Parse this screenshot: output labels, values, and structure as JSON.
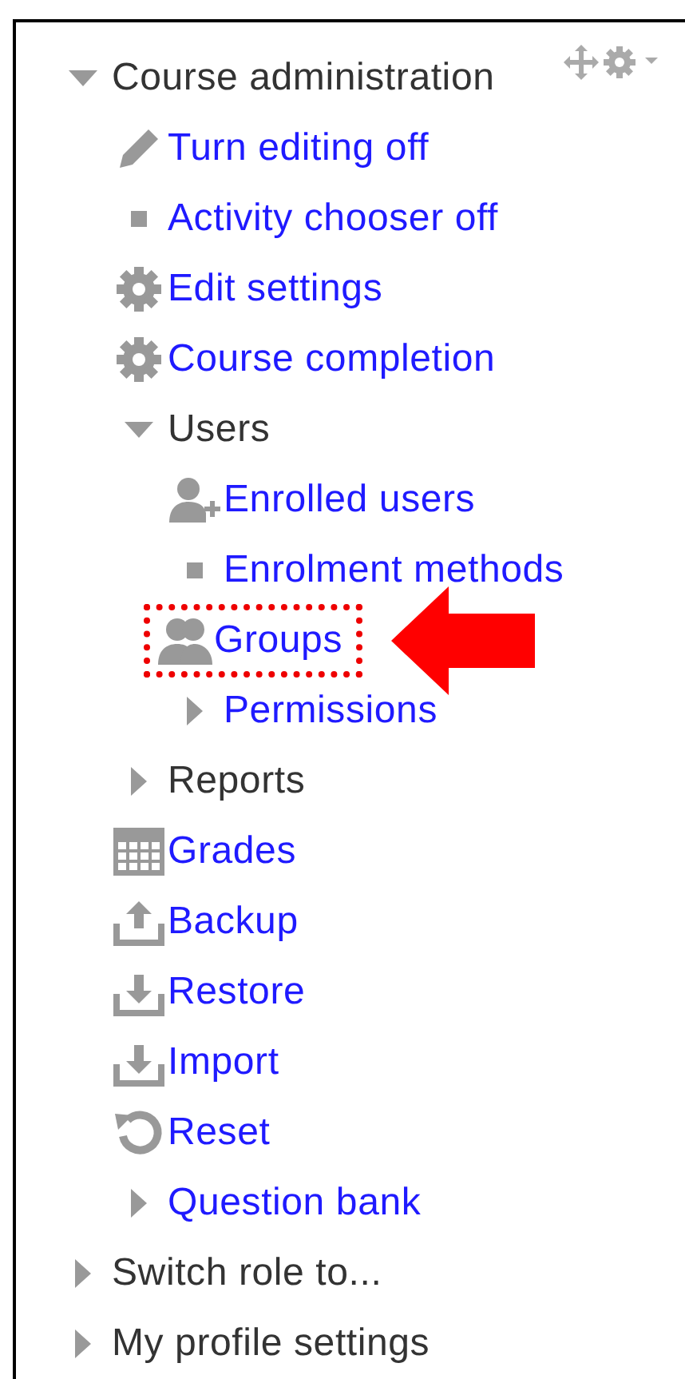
{
  "block": {
    "tree": [
      {
        "label": "Course administration",
        "kind": "branch",
        "expanded": true,
        "link": false,
        "highlighted": false,
        "children": [
          {
            "label": "Turn editing off",
            "kind": "edit",
            "link": true,
            "highlighted": false
          },
          {
            "label": "Activity chooser off",
            "kind": "bullet",
            "link": true,
            "highlighted": false
          },
          {
            "label": "Edit settings",
            "kind": "settings",
            "link": true,
            "highlighted": false
          },
          {
            "label": "Course completion",
            "kind": "settings",
            "link": true,
            "highlighted": false
          },
          {
            "label": "Users",
            "kind": "branch",
            "expanded": true,
            "link": false,
            "highlighted": false,
            "children": [
              {
                "label": "Enrolled users",
                "kind": "user-add",
                "link": true,
                "highlighted": false
              },
              {
                "label": "Enrolment methods",
                "kind": "bullet",
                "link": true,
                "highlighted": false
              },
              {
                "label": "Groups",
                "kind": "users",
                "link": true,
                "highlighted": true
              },
              {
                "label": "Permissions",
                "kind": "branch",
                "expanded": false,
                "link": true,
                "highlighted": false
              }
            ]
          },
          {
            "label": "Reports",
            "kind": "branch",
            "expanded": false,
            "link": false,
            "highlighted": false
          },
          {
            "label": "Grades",
            "kind": "grid",
            "link": true,
            "highlighted": false
          },
          {
            "label": "Backup",
            "kind": "upload",
            "link": true,
            "highlighted": false
          },
          {
            "label": "Restore",
            "kind": "download",
            "link": true,
            "highlighted": false
          },
          {
            "label": "Import",
            "kind": "download",
            "link": true,
            "highlighted": false
          },
          {
            "label": "Reset",
            "kind": "reset",
            "link": true,
            "highlighted": false
          },
          {
            "label": "Question bank",
            "kind": "branch",
            "expanded": false,
            "link": true,
            "highlighted": false
          }
        ]
      },
      {
        "label": "Switch role to...",
        "kind": "branch",
        "expanded": false,
        "link": false,
        "highlighted": false
      },
      {
        "label": "My profile settings",
        "kind": "branch",
        "expanded": false,
        "link": false,
        "highlighted": false
      }
    ]
  }
}
